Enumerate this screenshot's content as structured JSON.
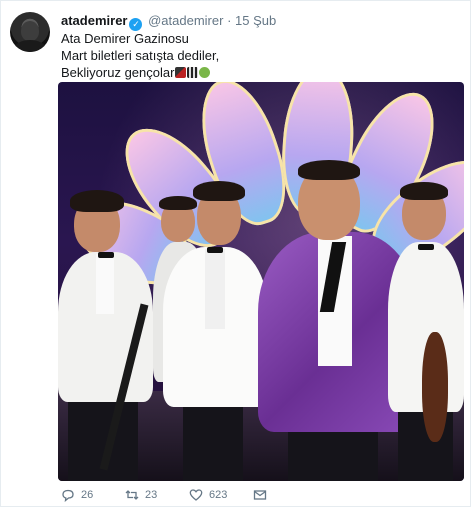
{
  "tweet": {
    "name": "atademirer",
    "handle": "@atademirer",
    "separator": "·",
    "time": "15 Şub",
    "lines": [
      "Ata Demirer Gazinosu",
      "Mart biletleri satışta dediler,",
      "Bekliyoruz gençolar"
    ],
    "emoji_names": [
      "saxophone-emoji",
      "musical-score-emoji",
      "performing-arts-emoji"
    ]
  },
  "actions": {
    "reply_count": "26",
    "retweet_count": "23",
    "like_count": "623"
  },
  "colors": {
    "verified": "#1da1f2",
    "jacket_purple": "#7b3fa8",
    "muted": "#657786"
  }
}
